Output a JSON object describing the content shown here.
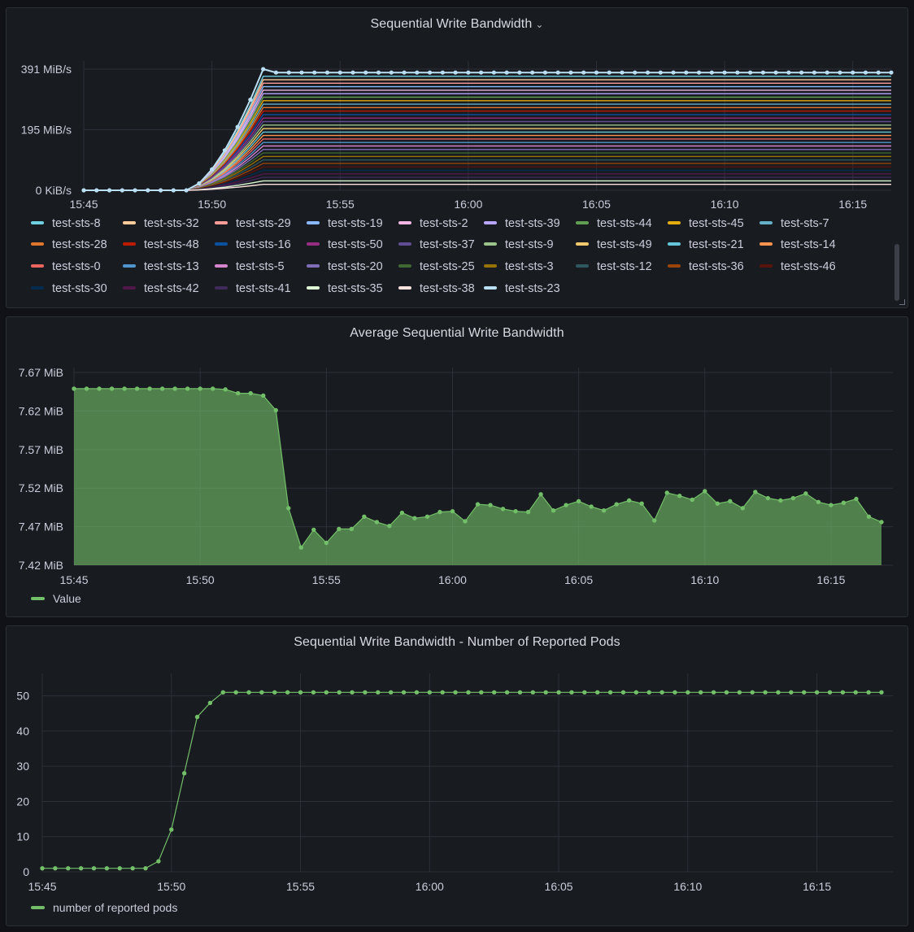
{
  "panels": {
    "p1": {
      "title": "Sequential Write Bandwidth",
      "chevron": "chevron-down-icon"
    },
    "p2": {
      "title": "Average Sequential Write Bandwidth"
    },
    "p3": {
      "title": "Sequential Write Bandwidth - Number of Reported Pods"
    }
  },
  "chart_data": [
    {
      "type": "line",
      "title": "Sequential Write Bandwidth",
      "x_ticks": [
        "15:45",
        "15:50",
        "15:55",
        "16:00",
        "16:05",
        "16:10",
        "16:15"
      ],
      "y_ticks": [
        "391 MiB/s",
        "195 MiB/s",
        "0 KiB/s"
      ],
      "ylim": [
        0,
        391
      ],
      "x_range": [
        "15:45",
        "16:16:30"
      ],
      "sample_interval_s": 30,
      "ramp_start": "15:49:00",
      "ramp_end": "15:52:00",
      "max_series": {
        "name": "test-sts-23",
        "plateau_value": 380,
        "peak_value": 391
      },
      "min_series_plateau_value": 8,
      "grid": true,
      "legend_position": "bottom",
      "series": [
        {
          "name": "test-sts-8",
          "color": "#6ed0e0"
        },
        {
          "name": "test-sts-32",
          "color": "#ffcb9a"
        },
        {
          "name": "test-sts-29",
          "color": "#ff9c97"
        },
        {
          "name": "test-sts-19",
          "color": "#8ab8ff"
        },
        {
          "name": "test-sts-2",
          "color": "#f0b5e2"
        },
        {
          "name": "test-sts-39",
          "color": "#b8a6ff"
        },
        {
          "name": "test-sts-44",
          "color": "#629e51"
        },
        {
          "name": "test-sts-45",
          "color": "#e5ac0e"
        },
        {
          "name": "test-sts-7",
          "color": "#64b0c8"
        },
        {
          "name": "test-sts-28",
          "color": "#e0752d"
        },
        {
          "name": "test-sts-48",
          "color": "#bf1b00"
        },
        {
          "name": "test-sts-16",
          "color": "#0a50a1"
        },
        {
          "name": "test-sts-50",
          "color": "#962d82"
        },
        {
          "name": "test-sts-37",
          "color": "#614d93"
        },
        {
          "name": "test-sts-9",
          "color": "#9ac48a"
        },
        {
          "name": "test-sts-49",
          "color": "#f2c96d"
        },
        {
          "name": "test-sts-21",
          "color": "#65c5db"
        },
        {
          "name": "test-sts-14",
          "color": "#f9934e"
        },
        {
          "name": "test-sts-0",
          "color": "#ea6460"
        },
        {
          "name": "test-sts-13",
          "color": "#5195ce"
        },
        {
          "name": "test-sts-5",
          "color": "#d683ce"
        },
        {
          "name": "test-sts-20",
          "color": "#806eb7"
        },
        {
          "name": "test-sts-25",
          "color": "#3f6833"
        },
        {
          "name": "test-sts-3",
          "color": "#967302"
        },
        {
          "name": "test-sts-12",
          "color": "#2f575e"
        },
        {
          "name": "test-sts-36",
          "color": "#99440a"
        },
        {
          "name": "test-sts-46",
          "color": "#58140c"
        },
        {
          "name": "test-sts-30",
          "color": "#052b51"
        },
        {
          "name": "test-sts-42",
          "color": "#511749"
        },
        {
          "name": "test-sts-41",
          "color": "#3f2b5b"
        },
        {
          "name": "test-sts-35",
          "color": "#e0f9d7"
        },
        {
          "name": "test-sts-38",
          "color": "#fce2de"
        },
        {
          "name": "test-sts-23",
          "color": "#badff4"
        }
      ]
    },
    {
      "type": "area",
      "title": "Average Sequential Write Bandwidth",
      "x_ticks": [
        "15:45",
        "15:50",
        "15:55",
        "16:00",
        "16:05",
        "16:10",
        "16:15"
      ],
      "y_ticks": [
        "7.67 MiB",
        "7.62 MiB",
        "7.57 MiB",
        "7.52 MiB",
        "7.47 MiB",
        "7.42 MiB"
      ],
      "ylim": [
        7.42,
        7.67
      ],
      "x_start": "15:45",
      "sample_interval_s": 30,
      "grid": true,
      "legend_position": "bottom-left",
      "series": [
        {
          "name": "Value",
          "color": "#73bf69",
          "values": [
            7.649,
            7.649,
            7.649,
            7.649,
            7.649,
            7.649,
            7.649,
            7.649,
            7.649,
            7.649,
            7.649,
            7.649,
            7.648,
            7.643,
            7.643,
            7.64,
            7.621,
            7.494,
            7.443,
            7.466,
            7.449,
            7.467,
            7.467,
            7.483,
            7.476,
            7.471,
            7.488,
            7.481,
            7.483,
            7.489,
            7.49,
            7.477,
            7.499,
            7.498,
            7.493,
            7.49,
            7.489,
            7.512,
            7.491,
            7.498,
            7.503,
            7.496,
            7.491,
            7.499,
            7.504,
            7.5,
            7.478,
            7.514,
            7.51,
            7.505,
            7.516,
            7.5,
            7.503,
            7.494,
            7.515,
            7.507,
            7.504,
            7.507,
            7.513,
            7.502,
            7.498,
            7.501,
            7.506,
            7.483,
            7.476
          ]
        }
      ]
    },
    {
      "type": "line",
      "title": "Sequential Write Bandwidth - Number of Reported Pods",
      "x_ticks": [
        "15:45",
        "15:50",
        "15:55",
        "16:00",
        "16:05",
        "16:10",
        "16:15"
      ],
      "y_ticks": [
        "50",
        "40",
        "30",
        "20",
        "10",
        "0"
      ],
      "ylim": [
        0,
        55
      ],
      "x_start": "15:45",
      "sample_interval_s": 30,
      "grid": true,
      "legend_position": "bottom-left",
      "series": [
        {
          "name": "number of reported pods",
          "color": "#73bf69",
          "values": [
            1,
            1,
            1,
            1,
            1,
            1,
            1,
            1,
            1,
            3,
            12,
            28,
            44,
            48,
            51,
            51,
            51,
            51,
            51,
            51,
            51,
            51,
            51,
            51,
            51,
            51,
            51,
            51,
            51,
            51,
            51,
            51,
            51,
            51,
            51,
            51,
            51,
            51,
            51,
            51,
            51,
            51,
            51,
            51,
            51,
            51,
            51,
            51,
            51,
            51,
            51,
            51,
            51,
            51,
            51,
            51,
            51,
            51,
            51,
            51,
            51,
            51,
            51,
            51,
            51,
            51
          ]
        }
      ]
    }
  ]
}
